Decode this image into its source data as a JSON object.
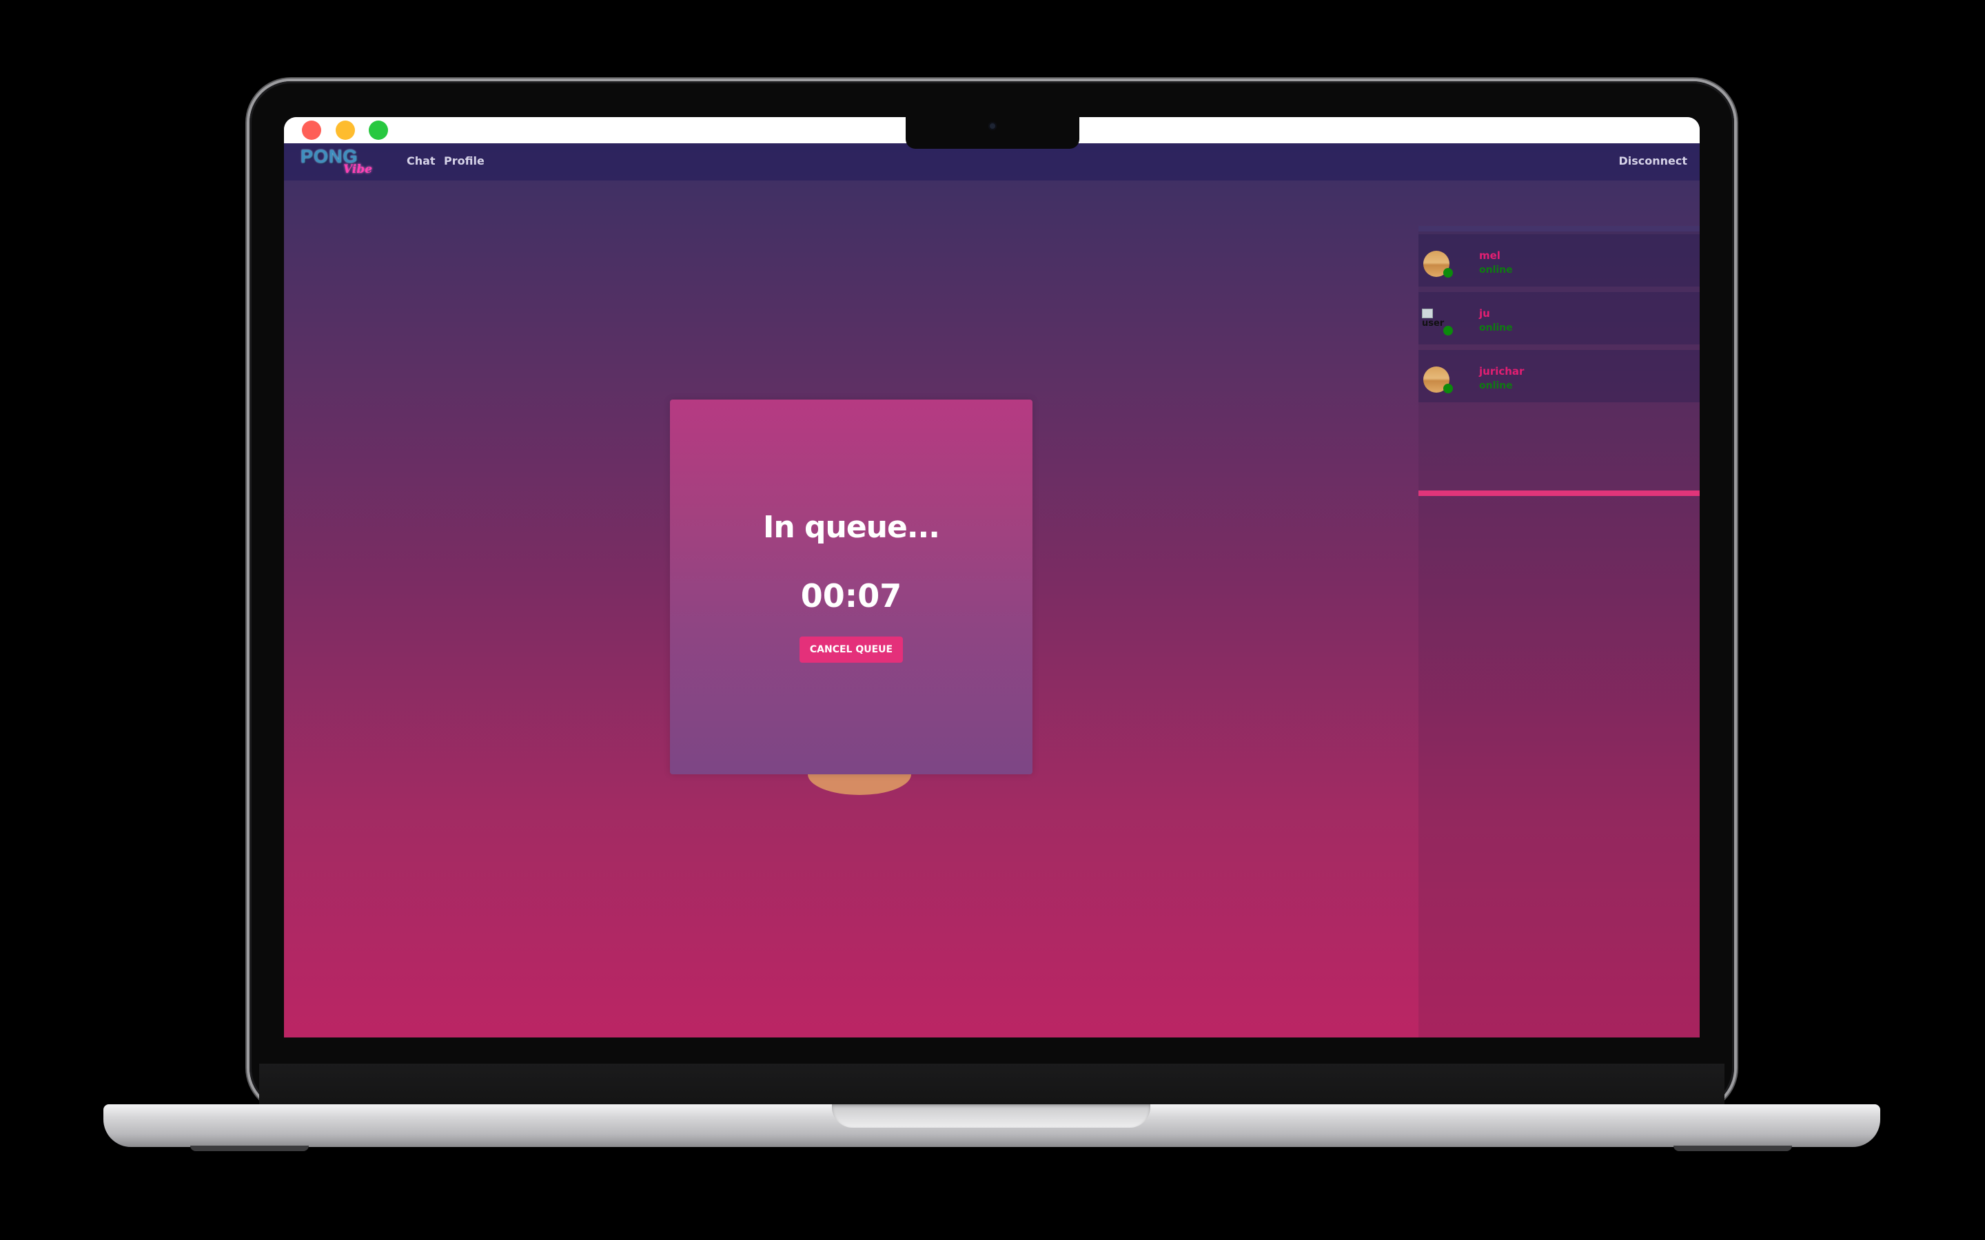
{
  "brand": {
    "logo_main": "PONG",
    "logo_sub": "Vibe"
  },
  "nav": {
    "chat": "Chat",
    "profile": "Profile",
    "disconnect": "Disconnect"
  },
  "friends": [
    {
      "name": "mel",
      "status": "online",
      "avatar": "sunset-avatar"
    },
    {
      "name": "ju",
      "status": "online",
      "avatar": "broken-image",
      "avatar_alt": "user"
    },
    {
      "name": "jurichar",
      "status": "online",
      "avatar": "sunset-avatar"
    }
  ],
  "queue": {
    "title": "In queue...",
    "timer": "00:07",
    "cancel_label": "CANCEL QUEUE"
  },
  "colors": {
    "accent": "#e4307a",
    "online": "#0f7a12",
    "friend_name": "#e21f72",
    "modal_top": "#b63a82",
    "modal_bottom": "#7d4685",
    "bg_top": "#3b3064",
    "bg_bottom": "#bb2564"
  }
}
